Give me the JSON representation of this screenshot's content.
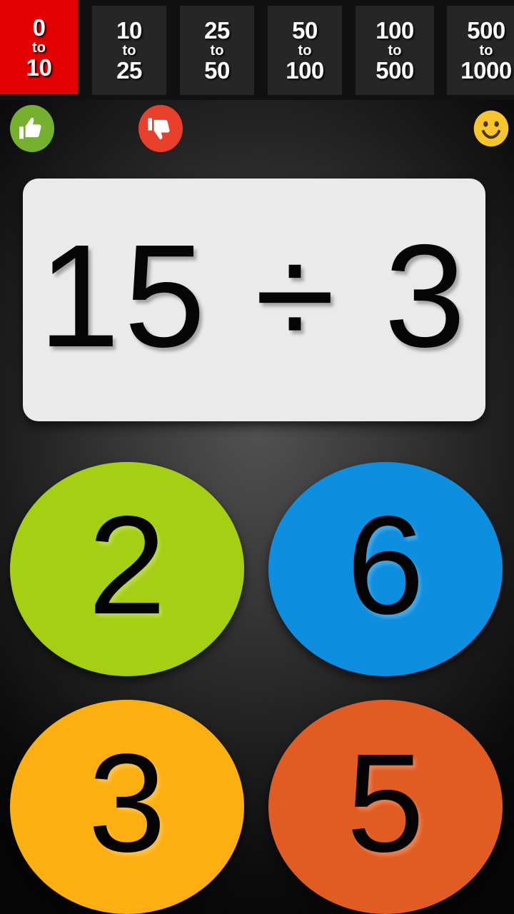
{
  "app": {
    "background_color": "#2f2f2f",
    "vignette_color": "#0b0b0b"
  },
  "range_tabs": {
    "active_index": 0,
    "active_color": "#e20000",
    "inactive_color": "#262626",
    "items": [
      {
        "name": "0-10",
        "from": "0",
        "to": "to",
        "upper": "10",
        "active": true
      },
      {
        "name": "10-25",
        "from": "10",
        "to": "to",
        "upper": "25",
        "active": false
      },
      {
        "name": "25-50",
        "from": "25",
        "to": "to",
        "upper": "50",
        "active": false
      },
      {
        "name": "50-100",
        "from": "50",
        "to": "to",
        "upper": "100",
        "active": false
      },
      {
        "name": "100-500",
        "from": "100",
        "to": "to",
        "upper": "500",
        "active": false
      },
      {
        "name": "500-1000",
        "from": "500",
        "to": "to",
        "upper": "1000",
        "active": false
      }
    ]
  },
  "status_icons": [
    {
      "icon": "thumbs-up-icon",
      "label": "correct",
      "color": "#76b02f"
    },
    {
      "icon": "thumbs-down-icon",
      "label": "wrong",
      "color": "#e8402a"
    },
    {
      "icon": "smiley-face-icon",
      "label": "mood",
      "color": "#f7c52b"
    }
  ],
  "question": {
    "operand_left": "15",
    "operator": "÷",
    "operand_right": "3",
    "text": "15 ÷ 3",
    "card_color": "#eaeaea",
    "text_color": "#050505"
  },
  "answers": [
    {
      "value": "2",
      "color": "#a6ce13"
    },
    {
      "value": "6",
      "color": "#0d8ede"
    },
    {
      "value": "3",
      "color": "#fcaf11"
    },
    {
      "value": "5",
      "color": "#e05c22"
    }
  ]
}
